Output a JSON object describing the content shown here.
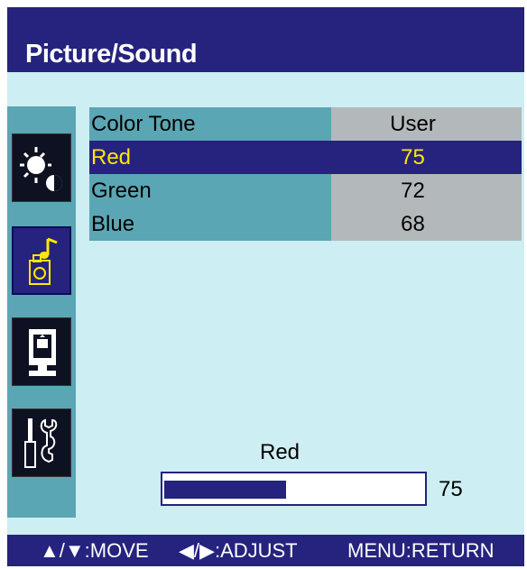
{
  "header": {
    "title": "Picture/Sound"
  },
  "sidebar": {
    "items": [
      {
        "name": "picture",
        "icon": "brightness-contrast-icon"
      },
      {
        "name": "sound",
        "icon": "music-note-speaker-icon",
        "active": true
      },
      {
        "name": "screen",
        "icon": "monitor-screen-icon"
      },
      {
        "name": "setup",
        "icon": "screwdriver-wrench-icon"
      }
    ]
  },
  "menu": {
    "rows": [
      {
        "label": "Color Tone",
        "value": "User"
      },
      {
        "label": "Red",
        "value": "75",
        "selected": true
      },
      {
        "label": "Green",
        "value": "72"
      },
      {
        "label": "Blue",
        "value": "68"
      }
    ]
  },
  "adjust": {
    "label": "Red",
    "value": "75",
    "fraction": 0.47
  },
  "footer": {
    "move": "▲/▼:MOVE",
    "adjust": "◀/▶:ADJUST",
    "return": "MENU:RETURN"
  },
  "colors": {
    "bar": "#25237e",
    "panel": "#cdeef3",
    "tab": "#5ba6b4",
    "selected_text": "#ffe800"
  }
}
